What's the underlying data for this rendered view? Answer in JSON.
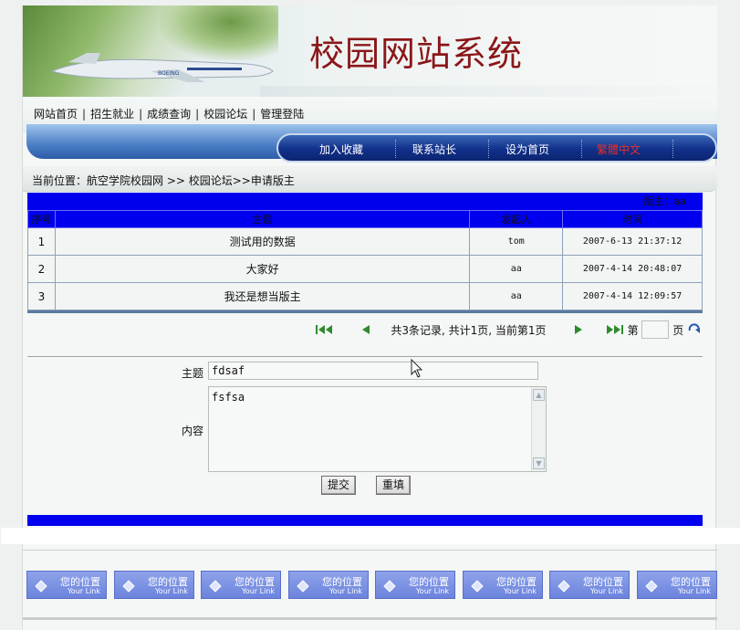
{
  "header": {
    "title": "校园网站系统"
  },
  "top_nav": {
    "items": [
      "网站首页",
      "招生就业",
      "成绩查询",
      "校园论坛",
      "管理登陆"
    ]
  },
  "blue_nav": {
    "items": [
      "加入收藏",
      "联系站长",
      "设为首页",
      "繁體中文"
    ],
    "item_colors": [
      "#ffffff",
      "#ffffff",
      "#ffffff",
      "#e03030"
    ]
  },
  "breadcrumb": "当前位置：航空学院校园网 >> 校园论坛>>申请版主",
  "table": {
    "moderator": "版主：aa",
    "columns": [
      "序号",
      "主题",
      "发起人",
      "时间"
    ],
    "rows": [
      {
        "no": "1",
        "subject": "测试用的数据",
        "author": "tom",
        "time": "2007-6-13 21:37:12"
      },
      {
        "no": "2",
        "subject": "大家好",
        "author": "aa",
        "time": "2007-4-14 20:48:07"
      },
      {
        "no": "3",
        "subject": "我还是想当版主",
        "author": "aa",
        "time": "2007-4-14 12:09:57"
      }
    ]
  },
  "pager": {
    "summary": "共3条记录, 共计1页, 当前第1页",
    "prefix": "第",
    "suffix": "页",
    "page_value": ""
  },
  "form": {
    "subject_label": "主题",
    "subject_value": "fdsaf",
    "content_label": "内容",
    "content_value": "fsfsa",
    "submit_label": "提交",
    "reset_label": "重填"
  },
  "footer_links": [
    {
      "label": "您的位置",
      "sub": "Your Link"
    },
    {
      "label": "您的位置",
      "sub": "Your Link"
    },
    {
      "label": "您的位置",
      "sub": "Your Link"
    },
    {
      "label": "您的位置",
      "sub": "Your Link"
    },
    {
      "label": "您的位置",
      "sub": "Your Link"
    },
    {
      "label": "您的位置",
      "sub": "Your Link"
    },
    {
      "label": "您的位置",
      "sub": "Your Link"
    },
    {
      "label": "您的位置",
      "sub": "Your Link"
    }
  ],
  "colors": {
    "title_red": "#8b1618",
    "table_header_blue": "#0000ee",
    "nav_blue": "#11308a"
  }
}
